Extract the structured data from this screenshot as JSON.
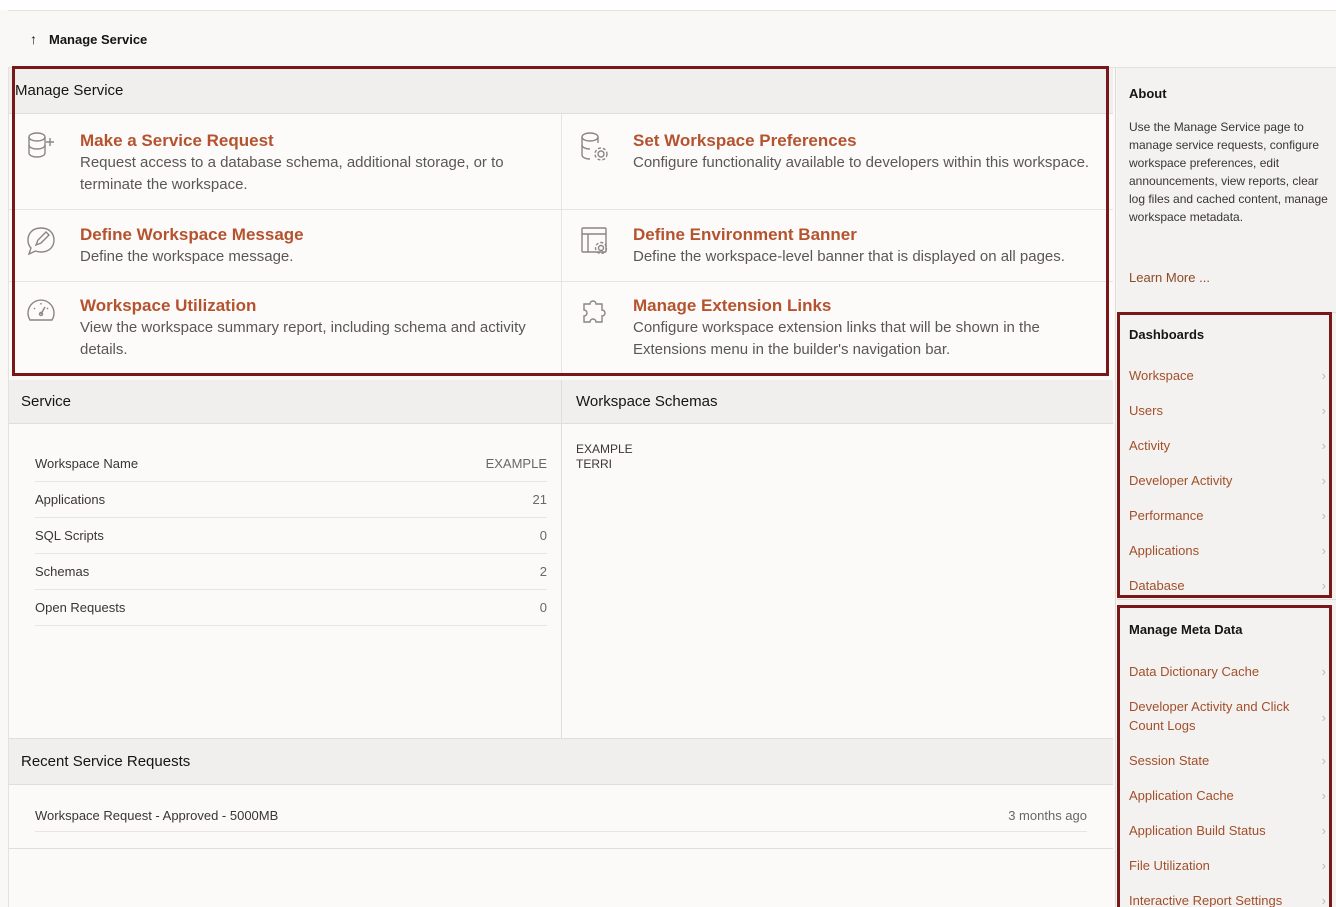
{
  "breadcrumb": {
    "label": "Manage Service"
  },
  "manage_service": {
    "title": "Manage Service",
    "cards": [
      {
        "title": "Make a Service Request",
        "desc": "Request access to a database schema, additional storage, or to terminate the workspace.",
        "icon": "database-add-icon"
      },
      {
        "title": "Set Workspace Preferences",
        "desc": "Configure functionality available to developers within this workspace.",
        "icon": "database-settings-icon"
      },
      {
        "title": "Define Workspace Message",
        "desc": "Define the workspace message.",
        "icon": "message-edit-icon"
      },
      {
        "title": "Define Environment Banner",
        "desc": "Define the workspace-level banner that is displayed on all pages.",
        "icon": "banner-settings-icon"
      },
      {
        "title": "Workspace Utilization",
        "desc": "View the workspace summary report, including schema and activity details.",
        "icon": "gauge-icon"
      },
      {
        "title": "Manage Extension Links",
        "desc": "Configure workspace extension links that will be shown in the Extensions menu in the builder's navigation bar.",
        "icon": "puzzle-icon"
      }
    ]
  },
  "service": {
    "title": "Service",
    "rows": [
      {
        "label": "Workspace Name",
        "value": "EXAMPLE"
      },
      {
        "label": "Applications",
        "value": "21"
      },
      {
        "label": "SQL Scripts",
        "value": "0"
      },
      {
        "label": "Schemas",
        "value": "2"
      },
      {
        "label": "Open Requests",
        "value": "0"
      }
    ]
  },
  "workspace_schemas": {
    "title": "Workspace Schemas",
    "items": [
      "EXAMPLE",
      "TERRI"
    ]
  },
  "recent_requests": {
    "title": "Recent Service Requests",
    "rows": [
      {
        "label": "Workspace Request - Approved - 5000MB",
        "time": "3 months ago"
      }
    ]
  },
  "sidebar": {
    "about": {
      "title": "About",
      "text": "Use the Manage Service page to manage service requests, configure workspace preferences, edit announcements, view reports, clear log files and cached content, manage workspace metadata.",
      "learn_more": "Learn More ..."
    },
    "dashboards": {
      "title": "Dashboards",
      "items": [
        "Workspace",
        "Users",
        "Activity",
        "Developer Activity",
        "Performance",
        "Applications",
        "Database"
      ]
    },
    "meta_data": {
      "title": "Manage Meta Data",
      "items": [
        "Data Dictionary Cache",
        "Developer Activity and Click Count Logs",
        "Session State",
        "Application Cache",
        "Application Build Status",
        "File Utilization",
        "Interactive Report Settings"
      ]
    }
  },
  "colors": {
    "accent": "#b5532f",
    "link": "#a24f2a",
    "outline": "#781818"
  }
}
